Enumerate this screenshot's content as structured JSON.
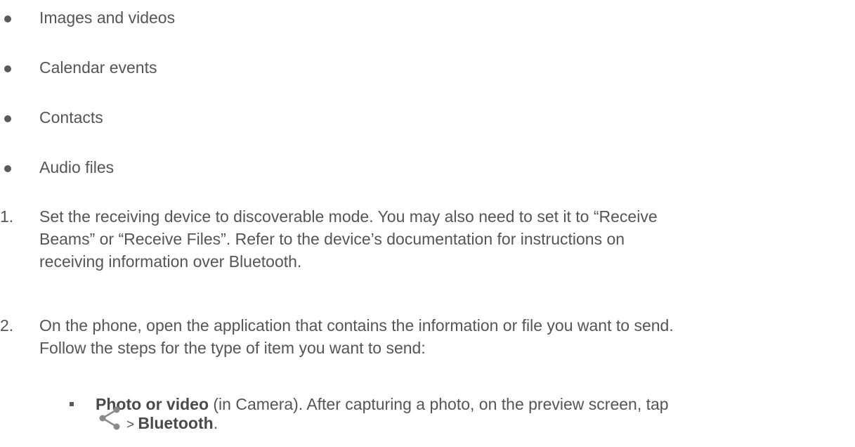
{
  "bullets": [
    {
      "text": "Images and videos"
    },
    {
      "text": "Calendar events"
    },
    {
      "text": "Contacts"
    },
    {
      "text": "Audio files"
    }
  ],
  "steps": [
    {
      "number": "1.",
      "lines": [
        "Set the receiving device to discoverable mode. You may also need to set it to “Receive",
        "Beams” or “Receive Files”. Refer to the device’s documentation for instructions on",
        "receiving information over Bluetooth."
      ]
    },
    {
      "number": "2.",
      "lines": [
        "On the phone, open the application that contains the information or file you want to send.",
        "Follow the steps for the type of item you want to send:"
      ]
    }
  ],
  "sub_item": {
    "title": "Photo or video",
    "text": " (in Camera). After capturing a photo, on the preview screen, tap",
    "separator": "> ",
    "action": "Bluetooth",
    "end": ".",
    "icon": "share-icon"
  },
  "colors": {
    "text": "#555555",
    "bullet": "#5a5a5a",
    "icon": "#8a8a8a"
  }
}
